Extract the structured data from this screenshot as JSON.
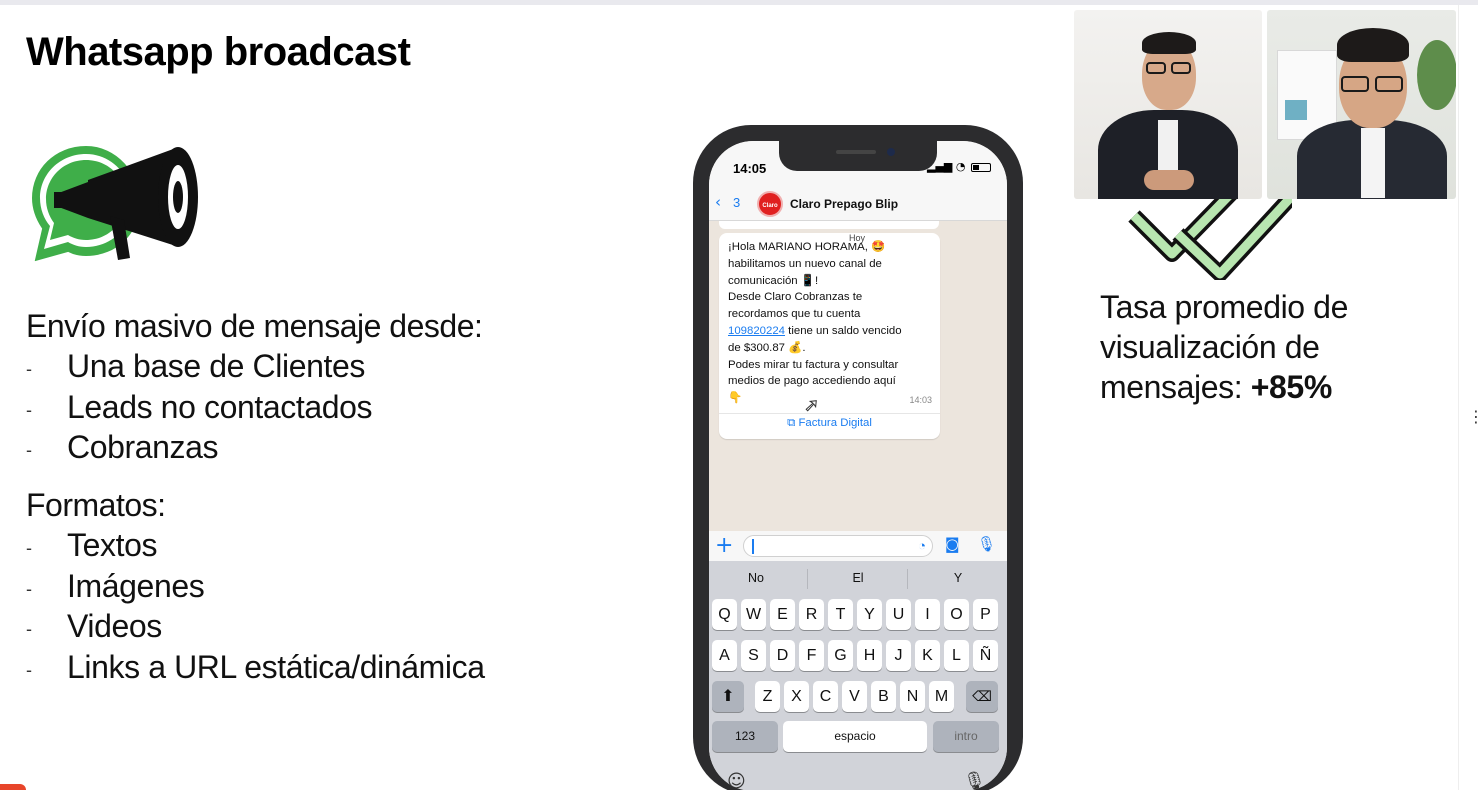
{
  "slide": {
    "title": "Whatsapp broadcast",
    "section1": {
      "heading": "Envío masivo de mensaje desde:",
      "bullets": [
        "Una base de Clientes",
        "Leads no contactados",
        "Cobranzas"
      ]
    },
    "section2": {
      "heading": "Formatos:",
      "bullets": [
        "Textos",
        "Imágenes",
        "Videos",
        "Links a URL estática/dinámica"
      ]
    },
    "bullet_marker": "-",
    "stat": {
      "line1": "Tasa promedio de",
      "line2": "visualización de",
      "line3_prefix": "mensajes: ",
      "line3_value": "+85%"
    }
  },
  "phone": {
    "clock": "14:05",
    "back_count": "3",
    "avatar_text": "Claro",
    "contact_name": "Claro Prepago Blip",
    "date_chip": "Hoy",
    "message": {
      "line1": "¡Hola MARIANO HORAMA, 🤩",
      "line2": "habilitamos un nuevo canal de",
      "line3": "comunicación 📱!",
      "line4": "Desde Claro Cobranzas te",
      "line5": "recordamos que tu cuenta",
      "account_link": "109820224",
      "line6_rest": " tiene un saldo vencido",
      "line7": "de $300.87 💰.",
      "line8": "Podes mirar tu factura y consultar",
      "line9": "medios de pago accediendo aquí",
      "line10": "👇",
      "time": "14:03",
      "button": "Factura Digital"
    },
    "keyboard": {
      "suggestions": [
        "No",
        "El",
        "Y"
      ],
      "row1": [
        "Q",
        "W",
        "E",
        "R",
        "T",
        "Y",
        "U",
        "I",
        "O",
        "P"
      ],
      "row2": [
        "A",
        "S",
        "D",
        "F",
        "G",
        "H",
        "J",
        "K",
        "L",
        "Ñ"
      ],
      "row3": [
        "Z",
        "X",
        "C",
        "V",
        "B",
        "N",
        "M"
      ],
      "num_key": "123",
      "space_key": "espacio",
      "return_key": "intro"
    }
  },
  "colors": {
    "whatsapp_green": "#3fae49",
    "link_blue": "#1a7cf0",
    "claro_red": "#e02020",
    "check_green": "#b8e6b0"
  }
}
